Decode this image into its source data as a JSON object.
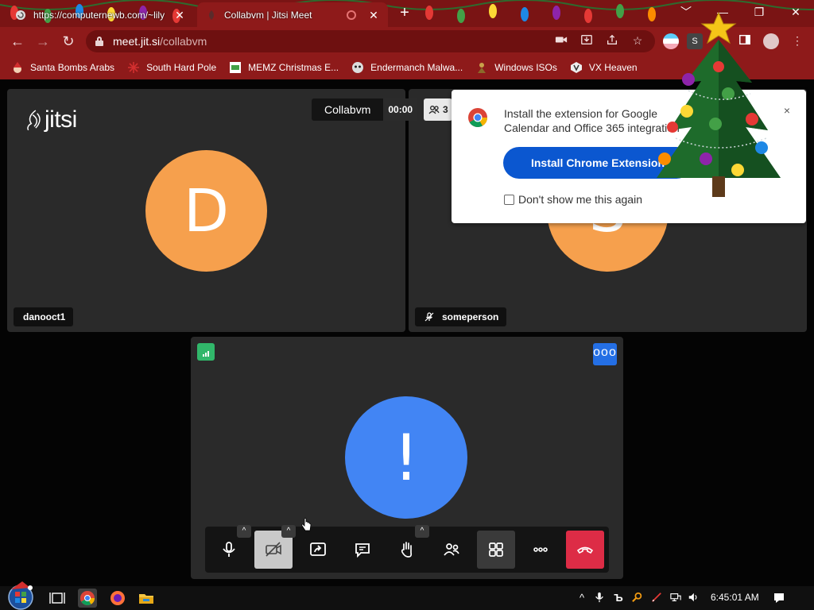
{
  "browser": {
    "tabs": [
      {
        "title": "https://computernewb.com/~lily",
        "active": false
      },
      {
        "title": "Collabvm | Jitsi Meet",
        "active": true
      }
    ],
    "new_tab_label": "+",
    "window_controls": {
      "dropdown": "﹀",
      "minimize": "—",
      "restore": "❐",
      "close": "✕"
    },
    "url_domain": "meet.jit.si",
    "url_path": "/collabvm",
    "bookmarks": [
      {
        "label": "Santa Bombs Arabs",
        "icon": "santa-icon"
      },
      {
        "label": "South Hard Pole",
        "icon": "snowflake-icon"
      },
      {
        "label": "MEMZ Christmas E...",
        "icon": "memz-icon"
      },
      {
        "label": "Endermanch Malwa...",
        "icon": "endermanch-icon"
      },
      {
        "label": "Windows ISOs",
        "icon": "windows-isos-icon"
      },
      {
        "label": "VX Heaven",
        "icon": "vx-heaven-icon"
      }
    ]
  },
  "meeting": {
    "subject": "Collabvm",
    "timer": "00:00",
    "participant_count": "3",
    "logo_text": "jitsi",
    "participants": [
      {
        "name": "danooct1",
        "initial": "D",
        "color": "#f6a04d"
      },
      {
        "name": "someperson",
        "initial": "S",
        "color": "#f6a04d",
        "muted": true
      }
    ],
    "local_avatar": {
      "initial": "!",
      "color": "#4285f4"
    },
    "more_label": "ooo"
  },
  "notification": {
    "text": "Install the extension for Google Calendar and Office 365 integration",
    "button": "Install Chrome Extension",
    "checkbox": "Don't show me this again",
    "close": "×"
  },
  "taskbar": {
    "clock": "6:45:01 AM"
  },
  "colors": {
    "chrome_frame": "#8e1a1a",
    "tile_bg": "#2a2a2a",
    "hangup": "#dd2c46",
    "install_button": "#0b57d0",
    "connection_good": "#31b76a"
  }
}
